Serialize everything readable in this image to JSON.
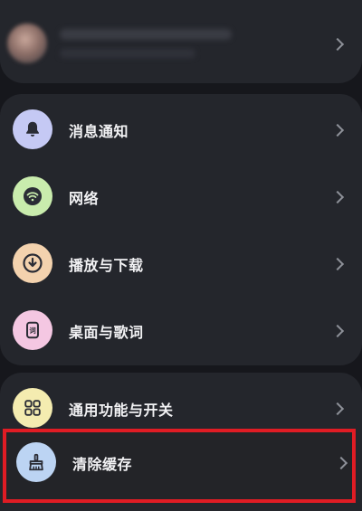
{
  "profile": {
    "avatar_icon": "avatar-icon",
    "chevron_icon": "chevron-right-icon"
  },
  "settings": {
    "items": [
      {
        "label": "消息通知",
        "icon": "bell-icon",
        "color": "#c5c9f4"
      },
      {
        "label": "网络",
        "icon": "wifi-icon",
        "color": "#c9ecad"
      },
      {
        "label": "播放与下载",
        "icon": "download-icon",
        "color": "#f3d2ae"
      },
      {
        "label": "桌面与歌词",
        "icon": "desktop-lyrics-icon",
        "color": "#f4c7e2"
      },
      {
        "label": "通用功能与开关",
        "icon": "grid-icon",
        "color": "#f4ecb0"
      },
      {
        "label": "清除缓存",
        "icon": "broom-icon",
        "color": "#bcd4f3"
      }
    ]
  },
  "highlight": {
    "color": "#e01c24",
    "target": "清除缓存"
  }
}
